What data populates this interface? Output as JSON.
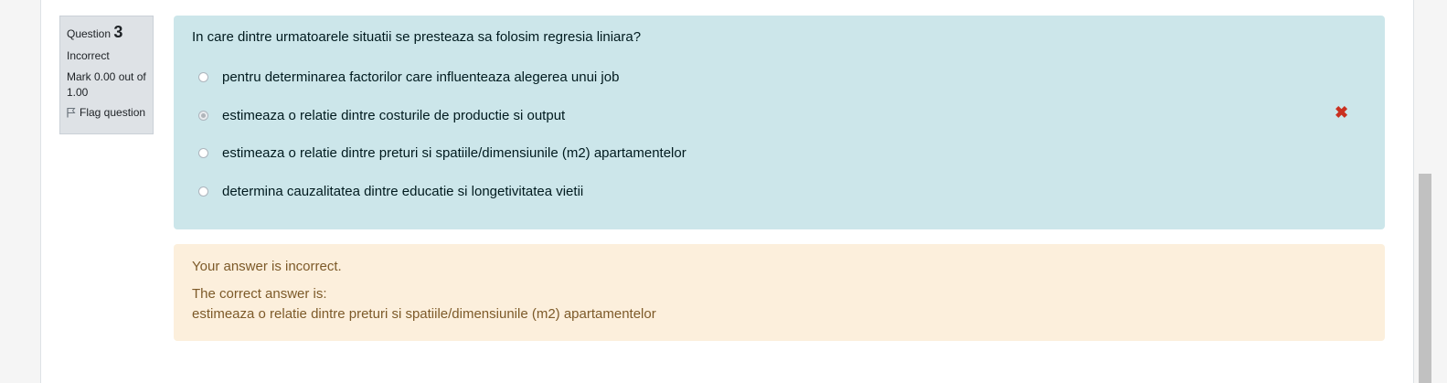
{
  "question": {
    "label": "Question",
    "number": "3",
    "state": "Incorrect",
    "grade_line1": "Mark 0.00 out of",
    "grade_line2": "1.00",
    "flag_label": "Flag question"
  },
  "formulation": {
    "text": "In care dintre urmatoarele situatii se presteaza sa folosim regresia liniara?",
    "options": [
      {
        "label": "pentru determinarea factorilor care influenteaza alegerea unui job",
        "selected": false
      },
      {
        "label": "estimeaza o relatie dintre costurile de productie si output",
        "selected": true
      },
      {
        "label": "estimeaza o relatie dintre preturi si spatiile/dimensiunile (m2) apartamentelor",
        "selected": false
      },
      {
        "label": "determina cauzalitatea dintre educatie si longetivitatea vietii",
        "selected": false
      }
    ],
    "incorrect_mark": "✖"
  },
  "outcome": {
    "feedback": "Your answer is incorrect.",
    "right_answer_label": "The correct answer is:",
    "right_answer": "estimeaza o relatie dintre preturi si spatiile/dimensiunile (m2) apartamentelor"
  },
  "colors": {
    "formulation_bg": "#cce6ea",
    "outcome_bg": "#fcefdc",
    "incorrect": "#ca3120"
  }
}
